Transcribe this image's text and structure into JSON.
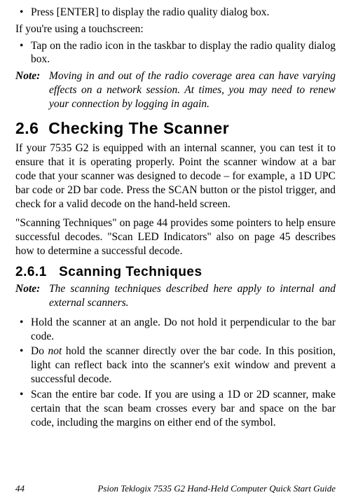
{
  "top_bullet": "Press [ENTER] to display the radio quality dialog box.",
  "touch_intro": "If you're using a touchscreen:",
  "touch_bullet": "Tap on the radio icon in the taskbar to display the radio quality dialog box.",
  "note1_label": "Note:",
  "note1_body": "Moving in and out of the radio coverage area can have varying effects on a network session. At times, you may need to renew your connection by logging in again.",
  "sec_number": "2.6",
  "sec_title": "Checking The Scanner",
  "sec_para1": "If your 7535 G2 is equipped with an internal scanner, you can test it to ensure that it is operating properly. Point the scanner window at a bar code that your scanner was designed to decode – for example, a 1D UPC bar code or 2D bar code. Press the SCAN button or the pistol trigger, and check for a valid decode on the hand-held screen.",
  "sec_para2": "\"Scanning Techniques\" on page 44 provides some pointers to help ensure successful decodes. \"Scan LED Indicators\" also on page 45 describes how to determine a successful decode.",
  "subsec_number": "2.6.1",
  "subsec_title": "Scanning Techniques",
  "note2_label": "Note:",
  "note2_body": "The scanning techniques described here apply to internal and external scanners.",
  "bullets": {
    "b1": "Hold the scanner at an angle. Do not hold it perpendicular to the bar code.",
    "b2_pre": "Do ",
    "b2_em": "not",
    "b2_post": " hold the scanner directly over the bar code. In this position, light can reflect back into the scanner's exit window and prevent a successful decode.",
    "b3": "Scan the entire bar code. If you are using a 1D or 2D scanner, make certain that the scan beam crosses every bar and space on the bar code, including the margins on either end of the symbol."
  },
  "footer_page": "44",
  "footer_text": "Psion Teklogix 7535 G2 Hand-Held Computer Quick Start Guide"
}
